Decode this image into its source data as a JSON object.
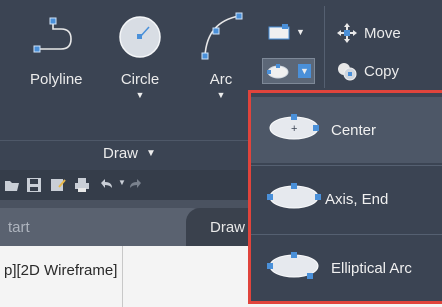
{
  "ribbon": {
    "tools": [
      {
        "label": "Polyline",
        "icon": "polyline-icon"
      },
      {
        "label": "Circle",
        "icon": "circle-icon",
        "has_dropdown": true
      },
      {
        "label": "Arc",
        "icon": "arc-icon",
        "has_dropdown": true
      }
    ],
    "modify": {
      "move_label": "Move",
      "copy_label": "Copy"
    },
    "panel_title": "Draw",
    "panel_caret": "▼"
  },
  "tabs": {
    "start_label": "tart",
    "drawing_label": "Draw"
  },
  "viewport": {
    "label": "p][2D Wireframe]"
  },
  "ellipse_menu": {
    "items": [
      {
        "label": "Center",
        "icon": "ellipse-center-icon"
      },
      {
        "label": "Axis, End",
        "icon": "ellipse-axis-end-icon"
      },
      {
        "label": "Elliptical Arc",
        "icon": "elliptical-arc-icon"
      }
    ]
  },
  "colors": {
    "ribbon_bg": "#3b4453",
    "accent_blue": "#4a90d9",
    "highlight_border": "#e0443c"
  }
}
